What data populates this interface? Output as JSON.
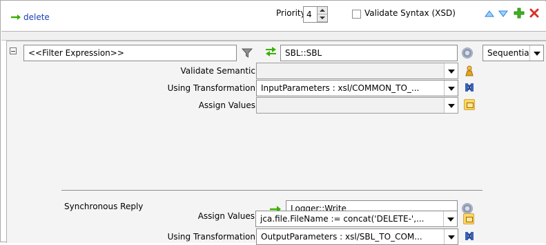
{
  "toolbar": {
    "delete_label": "delete",
    "priority_label": "Priority",
    "priority_value": "4",
    "validate_syntax_label": "Validate Syntax (XSD)"
  },
  "filter": {
    "expression": "<<Filter Expression>>",
    "target": "SBL::SBL",
    "mode": "Sequential"
  },
  "request": {
    "validate_semantic_label": "Validate Semantic",
    "validate_semantic_value": "",
    "using_transformation_label": "Using Transformation",
    "using_transformation_value": "InputParameters : xsl/COMMON_TO_...",
    "assign_values_label": "Assign Values",
    "assign_values_value": ""
  },
  "reply": {
    "synchronous_reply_label": "Synchronous Reply",
    "target": "Logger::Write",
    "using_transformation_label": "Using Transformation",
    "using_transformation_value": "OutputParameters : xsl/SBL_TO_COM...",
    "assign_values_label": "Assign Values",
    "assign_values_value": "jca.file.FileName := concat('DELETE-',..."
  },
  "colors": {
    "arrow_green": "#38b000",
    "link_blue": "#1a3fb5",
    "remove_red": "#d8322c",
    "triangle_blue": "#2d81d9"
  }
}
